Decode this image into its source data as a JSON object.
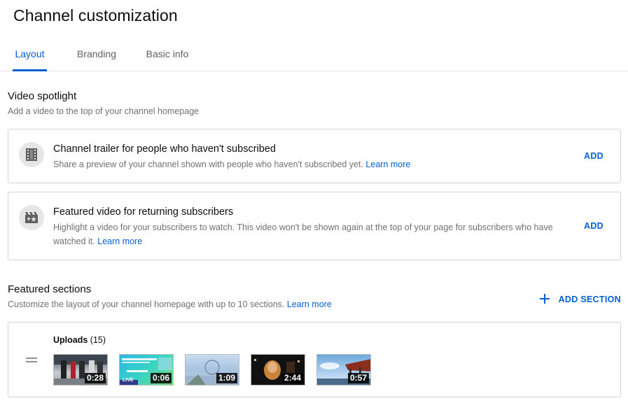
{
  "header": {
    "title": "Channel customization"
  },
  "tabs": [
    {
      "label": "Layout",
      "active": true
    },
    {
      "label": "Branding",
      "active": false
    },
    {
      "label": "Basic info",
      "active": false
    }
  ],
  "video_spotlight": {
    "title": "Video spotlight",
    "subtitle": "Add a video to the top of your channel homepage",
    "cards": [
      {
        "icon": "film-icon",
        "title": "Channel trailer for people who haven't subscribed",
        "description": "Share a preview of your channel shown with people who haven't subscribed yet.",
        "link": "Learn more",
        "action": "ADD"
      },
      {
        "icon": "featured-video-icon",
        "title": "Featured video for returning subscribers",
        "description": "Highlight a video for your subscribers to watch. This video won't be shown again at the top of your page for subscribers who have watched it.",
        "link": "Learn more",
        "action": "ADD"
      }
    ]
  },
  "featured_sections": {
    "title": "Featured sections",
    "subtitle": "Customize the layout of your channel homepage with up to 10 sections.",
    "link": "Learn more",
    "add_section_label": "ADD SECTION",
    "uploads": {
      "label": "Uploads",
      "count": "(15)",
      "videos": [
        {
          "duration": "0:28"
        },
        {
          "duration": "0:06",
          "badge": "LIVE"
        },
        {
          "duration": "1:09"
        },
        {
          "duration": "2:44"
        },
        {
          "duration": "0:57"
        }
      ]
    }
  },
  "colors": {
    "accent": "#065fd4",
    "text_primary": "#0d0d0d",
    "text_secondary": "#717171",
    "border": "#d3d3d3"
  }
}
